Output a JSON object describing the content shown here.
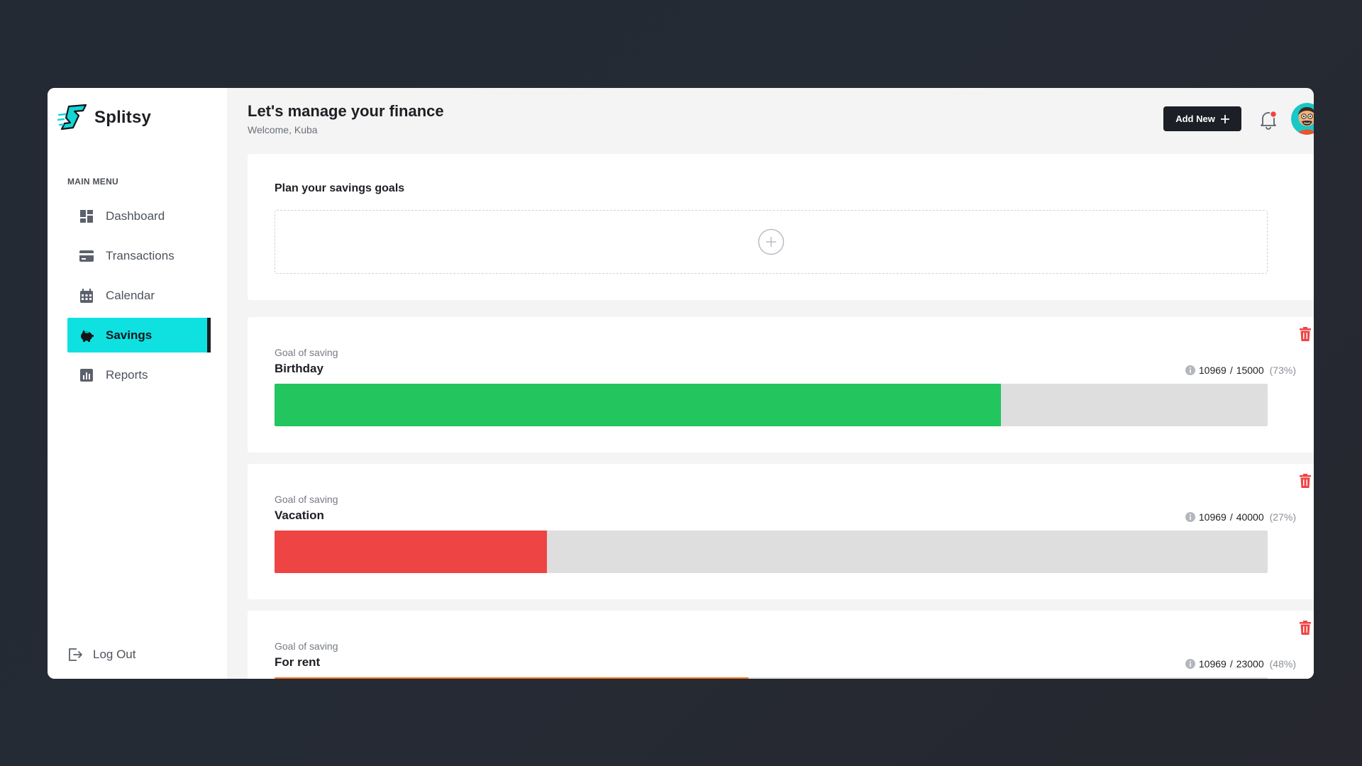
{
  "brand": {
    "name": "Splitsy"
  },
  "sidebar": {
    "heading": "MAIN MENU",
    "items": [
      {
        "label": "Dashboard",
        "icon": "dashboard-icon"
      },
      {
        "label": "Transactions",
        "icon": "credit-card-icon"
      },
      {
        "label": "Calendar",
        "icon": "calendar-icon"
      },
      {
        "label": "Savings",
        "icon": "piggy-bank-icon",
        "active": true
      },
      {
        "label": "Reports",
        "icon": "bar-chart-icon"
      }
    ],
    "logout_label": "Log Out"
  },
  "header": {
    "title": "Let's manage your finance",
    "subtitle": "Welcome, Kuba",
    "add_new_label": "Add New"
  },
  "plan": {
    "title": "Plan your savings goals"
  },
  "goals": [
    {
      "label": "Goal of saving",
      "name": "Birthday",
      "current": "10969",
      "target": "15000",
      "percent": "(73%)",
      "fraction": 0.7313,
      "color": "#22c55e"
    },
    {
      "label": "Goal of saving",
      "name": "Vacation",
      "current": "10969",
      "target": "40000",
      "percent": "(27%)",
      "fraction": 0.2742,
      "color": "#ef4444"
    },
    {
      "label": "Goal of saving",
      "name": "For rent",
      "current": "10969",
      "target": "23000",
      "percent": "(48%)",
      "fraction": 0.4769,
      "color": "#f97316"
    }
  ],
  "colors": {
    "accent": "#0fe1e1",
    "dark": "#1c1f25",
    "delete": "#ef4444",
    "notification": "#ef4444"
  }
}
